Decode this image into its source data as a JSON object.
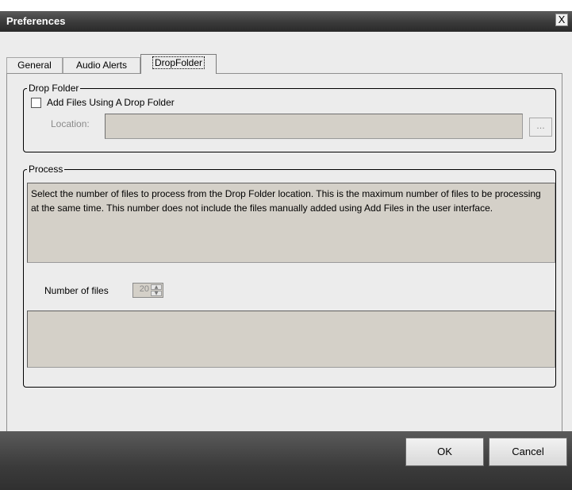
{
  "window": {
    "title": "Preferences",
    "close_glyph": "X"
  },
  "tabs": [
    {
      "label": "General",
      "active": false
    },
    {
      "label": "Audio Alerts",
      "active": false
    },
    {
      "label": "DropFolder",
      "active": true
    }
  ],
  "drop_folder": {
    "legend": "Drop Folder",
    "checkbox_label": "Add Files Using A Drop Folder",
    "checked": false,
    "location_label": "Location:",
    "location_value": "",
    "browse_label": "..."
  },
  "process": {
    "legend": "Process",
    "description": "Select the number of files to process from the Drop Folder location. This is the maximum number of files to be processing at the same time. This number does not include the files manually added using Add Files in the user interface.",
    "number_label": "Number of files",
    "number_value": "20",
    "status_text": ""
  },
  "buttons": {
    "ok": "OK",
    "cancel": "Cancel"
  }
}
